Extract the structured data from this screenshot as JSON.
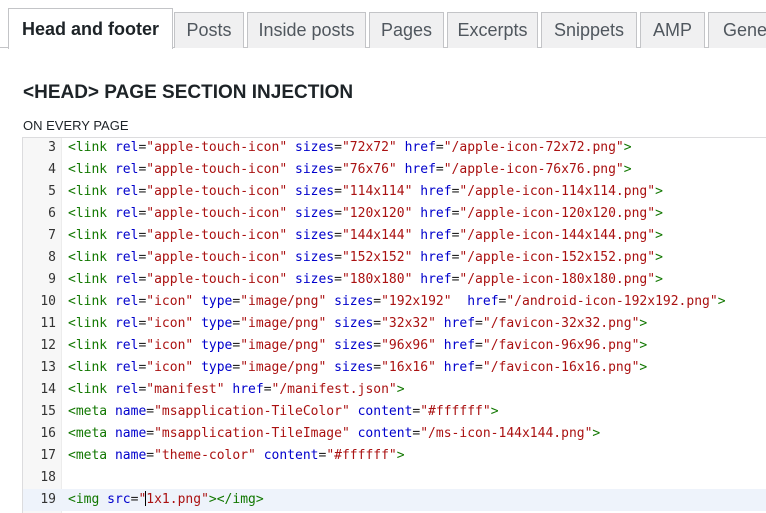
{
  "tabs": [
    {
      "label": "Head and footer",
      "active": true
    },
    {
      "label": "Posts",
      "active": false
    },
    {
      "label": "Inside posts",
      "active": false
    },
    {
      "label": "Pages",
      "active": false
    },
    {
      "label": "Excerpts",
      "active": false
    },
    {
      "label": "Snippets",
      "active": false
    },
    {
      "label": "AMP",
      "active": false
    },
    {
      "label": "Gener",
      "active": false
    }
  ],
  "section": {
    "title": "<HEAD> PAGE SECTION INJECTION",
    "subtitle": "ON EVERY PAGE"
  },
  "editor": {
    "cursor_line": "19",
    "lines": [
      {
        "num": "3",
        "tokens": [
          {
            "t": "tag",
            "v": "<link"
          },
          {
            "t": "txt",
            "v": " "
          },
          {
            "t": "attr",
            "v": "rel"
          },
          {
            "t": "txt",
            "v": "="
          },
          {
            "t": "str",
            "v": "\"apple-touch-icon\""
          },
          {
            "t": "txt",
            "v": " "
          },
          {
            "t": "attr",
            "v": "sizes"
          },
          {
            "t": "txt",
            "v": "="
          },
          {
            "t": "str",
            "v": "\"72x72\""
          },
          {
            "t": "txt",
            "v": " "
          },
          {
            "t": "attr",
            "v": "href"
          },
          {
            "t": "txt",
            "v": "="
          },
          {
            "t": "str",
            "v": "\"/apple-icon-72x72.png\""
          },
          {
            "t": "tag",
            "v": ">"
          }
        ]
      },
      {
        "num": "4",
        "tokens": [
          {
            "t": "tag",
            "v": "<link"
          },
          {
            "t": "txt",
            "v": " "
          },
          {
            "t": "attr",
            "v": "rel"
          },
          {
            "t": "txt",
            "v": "="
          },
          {
            "t": "str",
            "v": "\"apple-touch-icon\""
          },
          {
            "t": "txt",
            "v": " "
          },
          {
            "t": "attr",
            "v": "sizes"
          },
          {
            "t": "txt",
            "v": "="
          },
          {
            "t": "str",
            "v": "\"76x76\""
          },
          {
            "t": "txt",
            "v": " "
          },
          {
            "t": "attr",
            "v": "href"
          },
          {
            "t": "txt",
            "v": "="
          },
          {
            "t": "str",
            "v": "\"/apple-icon-76x76.png\""
          },
          {
            "t": "tag",
            "v": ">"
          }
        ]
      },
      {
        "num": "5",
        "tokens": [
          {
            "t": "tag",
            "v": "<link"
          },
          {
            "t": "txt",
            "v": " "
          },
          {
            "t": "attr",
            "v": "rel"
          },
          {
            "t": "txt",
            "v": "="
          },
          {
            "t": "str",
            "v": "\"apple-touch-icon\""
          },
          {
            "t": "txt",
            "v": " "
          },
          {
            "t": "attr",
            "v": "sizes"
          },
          {
            "t": "txt",
            "v": "="
          },
          {
            "t": "str",
            "v": "\"114x114\""
          },
          {
            "t": "txt",
            "v": " "
          },
          {
            "t": "attr",
            "v": "href"
          },
          {
            "t": "txt",
            "v": "="
          },
          {
            "t": "str",
            "v": "\"/apple-icon-114x114.png\""
          },
          {
            "t": "tag",
            "v": ">"
          }
        ]
      },
      {
        "num": "6",
        "tokens": [
          {
            "t": "tag",
            "v": "<link"
          },
          {
            "t": "txt",
            "v": " "
          },
          {
            "t": "attr",
            "v": "rel"
          },
          {
            "t": "txt",
            "v": "="
          },
          {
            "t": "str",
            "v": "\"apple-touch-icon\""
          },
          {
            "t": "txt",
            "v": " "
          },
          {
            "t": "attr",
            "v": "sizes"
          },
          {
            "t": "txt",
            "v": "="
          },
          {
            "t": "str",
            "v": "\"120x120\""
          },
          {
            "t": "txt",
            "v": " "
          },
          {
            "t": "attr",
            "v": "href"
          },
          {
            "t": "txt",
            "v": "="
          },
          {
            "t": "str",
            "v": "\"/apple-icon-120x120.png\""
          },
          {
            "t": "tag",
            "v": ">"
          }
        ]
      },
      {
        "num": "7",
        "tokens": [
          {
            "t": "tag",
            "v": "<link"
          },
          {
            "t": "txt",
            "v": " "
          },
          {
            "t": "attr",
            "v": "rel"
          },
          {
            "t": "txt",
            "v": "="
          },
          {
            "t": "str",
            "v": "\"apple-touch-icon\""
          },
          {
            "t": "txt",
            "v": " "
          },
          {
            "t": "attr",
            "v": "sizes"
          },
          {
            "t": "txt",
            "v": "="
          },
          {
            "t": "str",
            "v": "\"144x144\""
          },
          {
            "t": "txt",
            "v": " "
          },
          {
            "t": "attr",
            "v": "href"
          },
          {
            "t": "txt",
            "v": "="
          },
          {
            "t": "str",
            "v": "\"/apple-icon-144x144.png\""
          },
          {
            "t": "tag",
            "v": ">"
          }
        ]
      },
      {
        "num": "8",
        "tokens": [
          {
            "t": "tag",
            "v": "<link"
          },
          {
            "t": "txt",
            "v": " "
          },
          {
            "t": "attr",
            "v": "rel"
          },
          {
            "t": "txt",
            "v": "="
          },
          {
            "t": "str",
            "v": "\"apple-touch-icon\""
          },
          {
            "t": "txt",
            "v": " "
          },
          {
            "t": "attr",
            "v": "sizes"
          },
          {
            "t": "txt",
            "v": "="
          },
          {
            "t": "str",
            "v": "\"152x152\""
          },
          {
            "t": "txt",
            "v": " "
          },
          {
            "t": "attr",
            "v": "href"
          },
          {
            "t": "txt",
            "v": "="
          },
          {
            "t": "str",
            "v": "\"/apple-icon-152x152.png\""
          },
          {
            "t": "tag",
            "v": ">"
          }
        ]
      },
      {
        "num": "9",
        "tokens": [
          {
            "t": "tag",
            "v": "<link"
          },
          {
            "t": "txt",
            "v": " "
          },
          {
            "t": "attr",
            "v": "rel"
          },
          {
            "t": "txt",
            "v": "="
          },
          {
            "t": "str",
            "v": "\"apple-touch-icon\""
          },
          {
            "t": "txt",
            "v": " "
          },
          {
            "t": "attr",
            "v": "sizes"
          },
          {
            "t": "txt",
            "v": "="
          },
          {
            "t": "str",
            "v": "\"180x180\""
          },
          {
            "t": "txt",
            "v": " "
          },
          {
            "t": "attr",
            "v": "href"
          },
          {
            "t": "txt",
            "v": "="
          },
          {
            "t": "str",
            "v": "\"/apple-icon-180x180.png\""
          },
          {
            "t": "tag",
            "v": ">"
          }
        ]
      },
      {
        "num": "10",
        "tokens": [
          {
            "t": "tag",
            "v": "<link"
          },
          {
            "t": "txt",
            "v": " "
          },
          {
            "t": "attr",
            "v": "rel"
          },
          {
            "t": "txt",
            "v": "="
          },
          {
            "t": "str",
            "v": "\"icon\""
          },
          {
            "t": "txt",
            "v": " "
          },
          {
            "t": "attr",
            "v": "type"
          },
          {
            "t": "txt",
            "v": "="
          },
          {
            "t": "str",
            "v": "\"image/png\""
          },
          {
            "t": "txt",
            "v": " "
          },
          {
            "t": "attr",
            "v": "sizes"
          },
          {
            "t": "txt",
            "v": "="
          },
          {
            "t": "str",
            "v": "\"192x192\""
          },
          {
            "t": "txt",
            "v": "  "
          },
          {
            "t": "attr",
            "v": "href"
          },
          {
            "t": "txt",
            "v": "="
          },
          {
            "t": "str",
            "v": "\"/android-icon-192x192.png\""
          },
          {
            "t": "tag",
            "v": ">"
          }
        ]
      },
      {
        "num": "11",
        "tokens": [
          {
            "t": "tag",
            "v": "<link"
          },
          {
            "t": "txt",
            "v": " "
          },
          {
            "t": "attr",
            "v": "rel"
          },
          {
            "t": "txt",
            "v": "="
          },
          {
            "t": "str",
            "v": "\"icon\""
          },
          {
            "t": "txt",
            "v": " "
          },
          {
            "t": "attr",
            "v": "type"
          },
          {
            "t": "txt",
            "v": "="
          },
          {
            "t": "str",
            "v": "\"image/png\""
          },
          {
            "t": "txt",
            "v": " "
          },
          {
            "t": "attr",
            "v": "sizes"
          },
          {
            "t": "txt",
            "v": "="
          },
          {
            "t": "str",
            "v": "\"32x32\""
          },
          {
            "t": "txt",
            "v": " "
          },
          {
            "t": "attr",
            "v": "href"
          },
          {
            "t": "txt",
            "v": "="
          },
          {
            "t": "str",
            "v": "\"/favicon-32x32.png\""
          },
          {
            "t": "tag",
            "v": ">"
          }
        ]
      },
      {
        "num": "12",
        "tokens": [
          {
            "t": "tag",
            "v": "<link"
          },
          {
            "t": "txt",
            "v": " "
          },
          {
            "t": "attr",
            "v": "rel"
          },
          {
            "t": "txt",
            "v": "="
          },
          {
            "t": "str",
            "v": "\"icon\""
          },
          {
            "t": "txt",
            "v": " "
          },
          {
            "t": "attr",
            "v": "type"
          },
          {
            "t": "txt",
            "v": "="
          },
          {
            "t": "str",
            "v": "\"image/png\""
          },
          {
            "t": "txt",
            "v": " "
          },
          {
            "t": "attr",
            "v": "sizes"
          },
          {
            "t": "txt",
            "v": "="
          },
          {
            "t": "str",
            "v": "\"96x96\""
          },
          {
            "t": "txt",
            "v": " "
          },
          {
            "t": "attr",
            "v": "href"
          },
          {
            "t": "txt",
            "v": "="
          },
          {
            "t": "str",
            "v": "\"/favicon-96x96.png\""
          },
          {
            "t": "tag",
            "v": ">"
          }
        ]
      },
      {
        "num": "13",
        "tokens": [
          {
            "t": "tag",
            "v": "<link"
          },
          {
            "t": "txt",
            "v": " "
          },
          {
            "t": "attr",
            "v": "rel"
          },
          {
            "t": "txt",
            "v": "="
          },
          {
            "t": "str",
            "v": "\"icon\""
          },
          {
            "t": "txt",
            "v": " "
          },
          {
            "t": "attr",
            "v": "type"
          },
          {
            "t": "txt",
            "v": "="
          },
          {
            "t": "str",
            "v": "\"image/png\""
          },
          {
            "t": "txt",
            "v": " "
          },
          {
            "t": "attr",
            "v": "sizes"
          },
          {
            "t": "txt",
            "v": "="
          },
          {
            "t": "str",
            "v": "\"16x16\""
          },
          {
            "t": "txt",
            "v": " "
          },
          {
            "t": "attr",
            "v": "href"
          },
          {
            "t": "txt",
            "v": "="
          },
          {
            "t": "str",
            "v": "\"/favicon-16x16.png\""
          },
          {
            "t": "tag",
            "v": ">"
          }
        ]
      },
      {
        "num": "14",
        "tokens": [
          {
            "t": "tag",
            "v": "<link"
          },
          {
            "t": "txt",
            "v": " "
          },
          {
            "t": "attr",
            "v": "rel"
          },
          {
            "t": "txt",
            "v": "="
          },
          {
            "t": "str",
            "v": "\"manifest\""
          },
          {
            "t": "txt",
            "v": " "
          },
          {
            "t": "attr",
            "v": "href"
          },
          {
            "t": "txt",
            "v": "="
          },
          {
            "t": "str",
            "v": "\"/manifest.json\""
          },
          {
            "t": "tag",
            "v": ">"
          }
        ]
      },
      {
        "num": "15",
        "tokens": [
          {
            "t": "tag",
            "v": "<meta"
          },
          {
            "t": "txt",
            "v": " "
          },
          {
            "t": "attr",
            "v": "name"
          },
          {
            "t": "txt",
            "v": "="
          },
          {
            "t": "str",
            "v": "\"msapplication-TileColor\""
          },
          {
            "t": "txt",
            "v": " "
          },
          {
            "t": "attr",
            "v": "content"
          },
          {
            "t": "txt",
            "v": "="
          },
          {
            "t": "str",
            "v": "\"#ffffff\""
          },
          {
            "t": "tag",
            "v": ">"
          }
        ]
      },
      {
        "num": "16",
        "tokens": [
          {
            "t": "tag",
            "v": "<meta"
          },
          {
            "t": "txt",
            "v": " "
          },
          {
            "t": "attr",
            "v": "name"
          },
          {
            "t": "txt",
            "v": "="
          },
          {
            "t": "str",
            "v": "\"msapplication-TileImage\""
          },
          {
            "t": "txt",
            "v": " "
          },
          {
            "t": "attr",
            "v": "content"
          },
          {
            "t": "txt",
            "v": "="
          },
          {
            "t": "str",
            "v": "\"/ms-icon-144x144.png\""
          },
          {
            "t": "tag",
            "v": ">"
          }
        ]
      },
      {
        "num": "17",
        "tokens": [
          {
            "t": "tag",
            "v": "<meta"
          },
          {
            "t": "txt",
            "v": " "
          },
          {
            "t": "attr",
            "v": "name"
          },
          {
            "t": "txt",
            "v": "="
          },
          {
            "t": "str",
            "v": "\"theme-color\""
          },
          {
            "t": "txt",
            "v": " "
          },
          {
            "t": "attr",
            "v": "content"
          },
          {
            "t": "txt",
            "v": "="
          },
          {
            "t": "str",
            "v": "\"#ffffff\""
          },
          {
            "t": "tag",
            "v": ">"
          }
        ]
      },
      {
        "num": "18",
        "tokens": []
      },
      {
        "num": "19",
        "tokens": [
          {
            "t": "tag",
            "v": "<img"
          },
          {
            "t": "txt",
            "v": " "
          },
          {
            "t": "attr",
            "v": "src"
          },
          {
            "t": "txt",
            "v": "="
          },
          {
            "t": "str",
            "v": "\""
          },
          {
            "t": "caret",
            "v": ""
          },
          {
            "t": "str",
            "v": "1x1.png\""
          },
          {
            "t": "tag",
            "v": "></img>"
          }
        ]
      }
    ]
  },
  "colors": {
    "tag": "#117700",
    "attribute": "#0000cc",
    "string": "#aa1111",
    "active_line_bg": "#eef3fb",
    "tab_inactive_bg": "#f0f0f1",
    "tab_border": "#c3c4c7"
  }
}
